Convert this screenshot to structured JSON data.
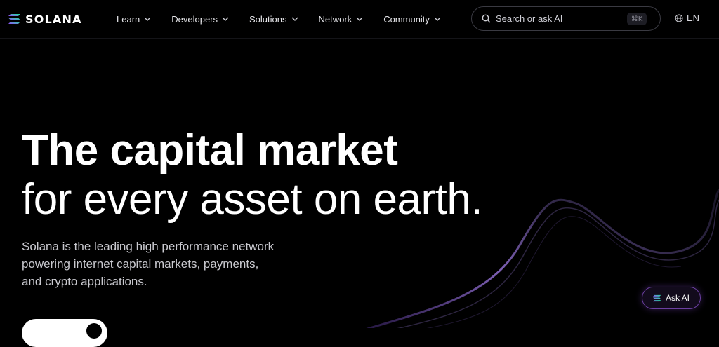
{
  "brand": {
    "name": "SOLANA",
    "logo_icon": "solana-logo-icon"
  },
  "nav": {
    "items": [
      {
        "label": "Learn",
        "icon": "chevron-down-icon"
      },
      {
        "label": "Developers",
        "icon": "chevron-down-icon"
      },
      {
        "label": "Solutions",
        "icon": "chevron-down-icon"
      },
      {
        "label": "Network",
        "icon": "chevron-down-icon"
      },
      {
        "label": "Community",
        "icon": "chevron-down-icon"
      }
    ]
  },
  "search": {
    "placeholder": "Search or ask AI",
    "shortcut": "⌘K",
    "icon": "search-icon"
  },
  "language": {
    "label": "EN",
    "icon": "globe-icon"
  },
  "hero": {
    "title_line1": "The capital market",
    "title_line2": "for every asset on earth.",
    "description": "Solana is the leading high performance network powering internet capital markets, payments, and crypto applications."
  },
  "ask_ai": {
    "label": "Ask AI",
    "icon": "solana-logo-icon"
  },
  "colors": {
    "background": "#000000",
    "accent_purple": "#9945FF",
    "accent_green": "#14F195",
    "text": "#FFFFFF"
  }
}
